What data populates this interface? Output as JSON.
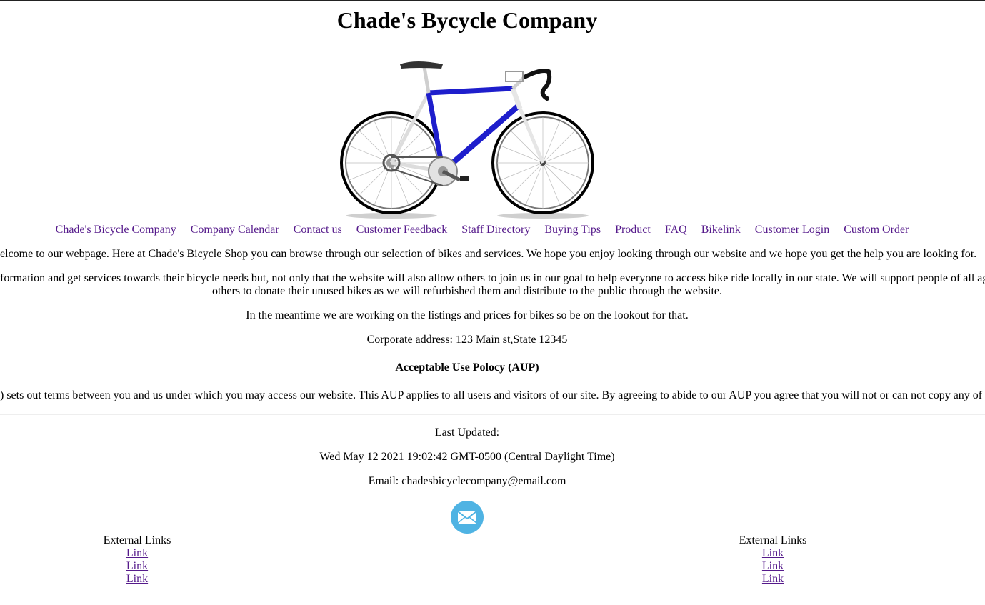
{
  "header": {
    "title": "Chade's Bycycle Company"
  },
  "nav": {
    "items": [
      "Chade's Bicycle Company",
      "Company Calendar",
      "Contact us",
      "Customer Feedback",
      "Staff Directory",
      "Buying Tips",
      "Product",
      "FAQ",
      "Bikelink",
      "Customer Login",
      "Custom Order"
    ]
  },
  "content": {
    "welcome": "elcome to our webpage. Here at Chade's Bicycle Shop you can browse through our selection of bikes and services. We hope you enjoy looking through our website and we hope you get the help you are looking for.",
    "mission_line1": "formation and get services towards their bicycle needs but, not only that the website will also allow others to join us in our goal to help everyone to access bike ride locally in our state. We will support people of all age",
    "mission_line2": "others to donate their unused bikes as we will refurbished them and distribute to the public through the website.",
    "meantime": "In the meantime we are working on the listings and prices for bikes so be on the lookout for that.",
    "address": "Corporate address: 123 Main st,State 12345",
    "aup_title": "Acceptable Use Polocy (AUP)",
    "aup_text": ") sets out terms between you and us under which you may access our website. This AUP applies to all users and visitors of our site. By agreeing to abide to our AUP you agree that you will not or can not copy any of c"
  },
  "footer": {
    "last_updated_label": "Last Updated:",
    "last_updated_value": "Wed May 12 2021 19:02:42 GMT-0500 (Central Daylight Time)",
    "email": "Email: chadesbicyclecompany@email.com",
    "mail_icon": "envelope-icon",
    "external_left": {
      "heading": "External Links",
      "links": [
        "Link",
        "Link",
        "Link"
      ]
    },
    "external_right": {
      "heading": "External Links",
      "links": [
        "Link",
        "Link",
        "Link"
      ]
    }
  },
  "colors": {
    "link": "#551a8b",
    "bike_frame": "#1e1ecc",
    "mail_circle": "#4fb3e3"
  }
}
